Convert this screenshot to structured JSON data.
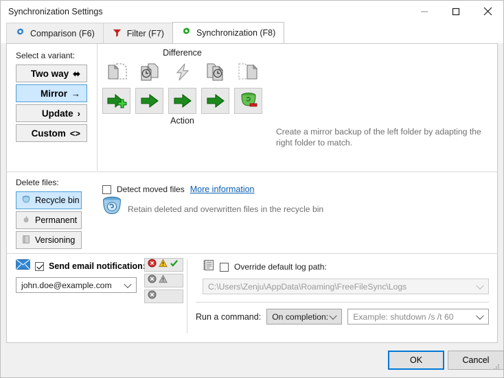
{
  "window": {
    "title": "Synchronization Settings",
    "controls": [
      {
        "name": "minimize",
        "glyph": "minimize-icon"
      },
      {
        "name": "maximize",
        "glyph": "maximize-icon"
      },
      {
        "name": "close",
        "glyph": "close-icon"
      }
    ]
  },
  "tabs": [
    {
      "label": "Comparison (F6)",
      "icon": "gear-icon-blue",
      "active": false
    },
    {
      "label": "Filter (F7)",
      "icon": "funnel-icon-red",
      "active": false
    },
    {
      "label": "Synchronization (F8)",
      "icon": "gear-icon-green",
      "active": true
    }
  ],
  "variant": {
    "label": "Select a variant:",
    "options": [
      {
        "label": "Two way",
        "glyph": "⬌",
        "selected": false
      },
      {
        "label": "Mirror",
        "glyph": "→",
        "selected": true
      },
      {
        "label": "Update",
        "glyph": "›",
        "selected": false
      },
      {
        "label": "Custom",
        "glyph": "<>",
        "selected": false
      }
    ],
    "description": "Create a mirror backup of the left folder by adapting the right folder to match."
  },
  "grid": {
    "difference_title": "Difference",
    "action_title": "Action",
    "difference_icons": [
      "file-left-only-icon",
      "file-left-newer-icon",
      "conflict-lightning-icon",
      "file-right-newer-icon",
      "file-right-only-icon"
    ],
    "action_icons": [
      "arrow-right-create-icon",
      "arrow-right-icon",
      "arrow-right-icon",
      "arrow-right-icon",
      "recycle-bin-delete-icon"
    ]
  },
  "detect_moved": {
    "label": "Detect moved files",
    "checked": false,
    "link": "More information"
  },
  "delete_files": {
    "label": "Delete files:",
    "options": [
      {
        "label": "Recycle bin",
        "icon": "recycle-bin-icon",
        "selected": true
      },
      {
        "label": "Permanent",
        "icon": "flame-icon",
        "selected": false
      },
      {
        "label": "Versioning",
        "icon": "book-icon",
        "selected": false
      }
    ],
    "description": "Retain deleted and overwritten files in the recycle bin"
  },
  "email": {
    "label": "Send email notification:",
    "checked": true,
    "icon": "envelope-icon",
    "address": "john.doe@example.com",
    "conditions": [
      {
        "name": "error-warning-success",
        "icons": [
          "error",
          "warning",
          "success"
        ],
        "enabled": true
      },
      {
        "name": "error-warning",
        "icons": [
          "error",
          "warning"
        ],
        "enabled": false
      },
      {
        "name": "error-only",
        "icons": [
          "error"
        ],
        "enabled": false
      }
    ]
  },
  "log_path": {
    "label": "Override default log path:",
    "checked": false,
    "icon": "log-list-icon",
    "value": "C:\\Users\\Zenju\\AppData\\Roaming\\FreeFileSync\\Logs"
  },
  "run_command": {
    "label": "Run a command:",
    "timing": "On completion:",
    "placeholder": "Example: shutdown /s /t 60"
  },
  "footer": {
    "ok": "OK",
    "cancel": "Cancel"
  }
}
